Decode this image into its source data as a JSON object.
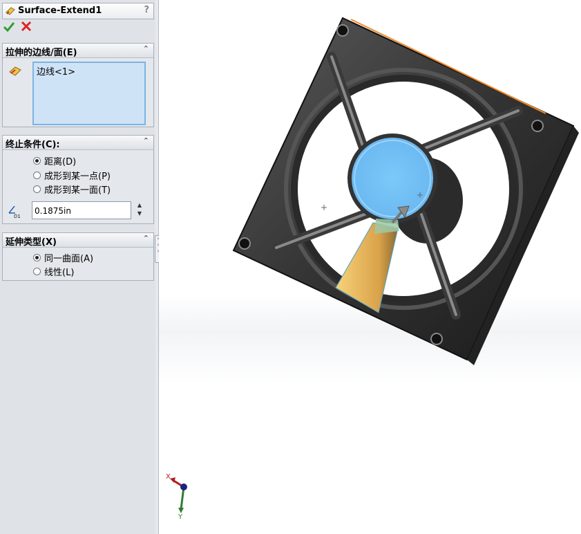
{
  "property_manager": {
    "title": "Surface-Extend1",
    "help_label": "?",
    "ok_icon": "green-check-icon",
    "cancel_icon": "red-x-icon"
  },
  "section_edges": {
    "title": "拉伸的边线/面(E)",
    "list_items": [
      "边线<1>"
    ]
  },
  "section_end": {
    "title": "终止条件(C):",
    "options": [
      {
        "label": "距离(D)",
        "selected": true
      },
      {
        "label": "成形到某一点(P)",
        "selected": false
      },
      {
        "label": "成形到某一面(T)",
        "selected": false
      }
    ],
    "distance_value": "0.1875in",
    "distance_icon_label": "D1"
  },
  "section_type": {
    "title": "延伸类型(X)",
    "options": [
      {
        "label": "同一曲面(A)",
        "selected": true
      },
      {
        "label": "线性(L)",
        "selected": false
      }
    ]
  },
  "triad": {
    "x_label": "X",
    "y_label": "Y"
  },
  "colors": {
    "panel_bg": "#dfe3e8",
    "selection_bg": "#cfe3f7",
    "fan_face": "#76c4f8",
    "extend_surface": "#e5b45a",
    "edge_highlight": "#f08a2a"
  }
}
